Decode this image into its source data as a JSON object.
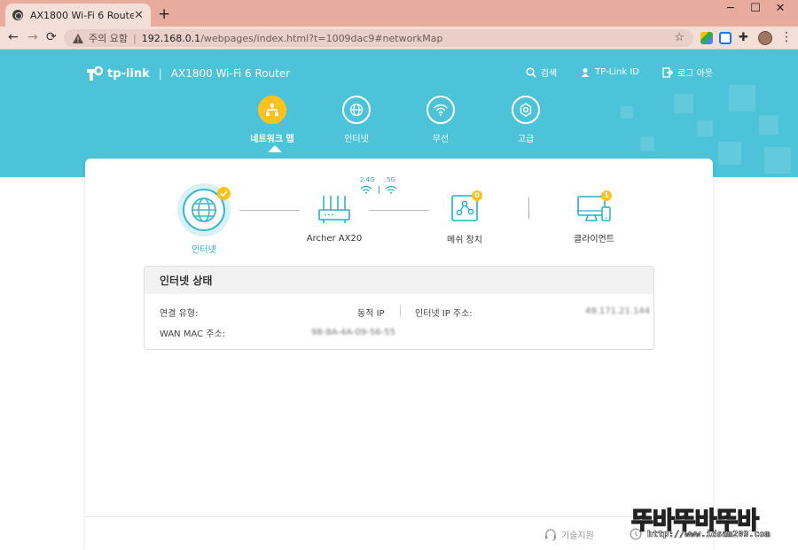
{
  "browser": {
    "tab_title": "AX1800 Wi-Fi 6 Router",
    "tab_close": "✕",
    "new_tab": "+",
    "minimize": "─",
    "maximize": "☐",
    "close": "✕",
    "back": "←",
    "forward": "→",
    "reload": "⟳",
    "security_label": "주의 요함",
    "url_separator": "|",
    "url_host": "192.168.0.1",
    "url_path": "/webpages/index.html?t=1009dac9#networkMap",
    "bookmark": "☆",
    "menu": "⋮",
    "accent": "#e8ac9f"
  },
  "brand": {
    "logo_text": "tp-link",
    "divider": "|",
    "model": "AX1800 Wi-Fi 6 Router"
  },
  "top_links": {
    "search": "검색",
    "tplink_id": "TP-Link ID",
    "logout": "로그 아웃"
  },
  "nav": {
    "items": [
      {
        "label": "네트워크 맵",
        "icon": "network-map-icon",
        "active": true
      },
      {
        "label": "인터넷",
        "icon": "globe-icon",
        "active": false
      },
      {
        "label": "무선",
        "icon": "wifi-icon",
        "active": false
      },
      {
        "label": "고급",
        "icon": "gear-icon",
        "active": false
      }
    ]
  },
  "network_map": {
    "internet_label": "인터넷",
    "router_label": "Archer AX20",
    "band_24": "2.4G",
    "band_5": "5G",
    "mesh_label": "메쉬 장치",
    "mesh_count": "0",
    "clients_label": "클라이언트",
    "clients_count": "1"
  },
  "status": {
    "title": "인터넷 상태",
    "connection_type_label": "연결 유형:",
    "connection_type_value": "동적 IP",
    "internet_ip_label": "인터넷 IP 주소:",
    "internet_ip_value": "49.171.21.144",
    "wan_mac_label": "WAN MAC 주소:",
    "wan_mac_value": "98-8A-4A-09-56-55"
  },
  "footer": {
    "support": "기술지원"
  },
  "watermark": {
    "title": "뚜바뚜바뚜바",
    "url": "http://www.idsam209.com"
  },
  "colors": {
    "header_bg": "#4cc3d9",
    "active_nav": "#ffc21d",
    "teal": "#1eb2c9"
  }
}
